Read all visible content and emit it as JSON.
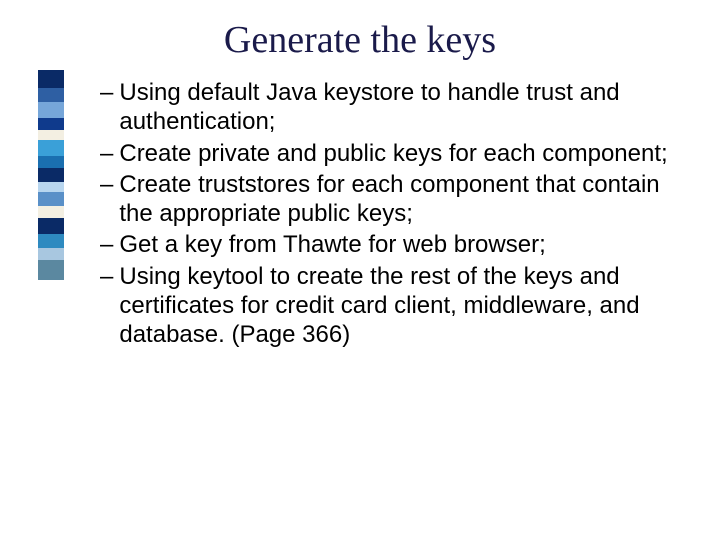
{
  "title": "Generate the keys",
  "bullets": [
    "Using default Java keystore to handle trust and authentication;",
    "Create private and public keys for each component;",
    "Create truststores for each component that contain the appropriate public keys;",
    "Get a key from Thawte for web browser;",
    "Using keytool to create the rest of the keys and certificates for credit card client, middleware, and database. (Page 366)"
  ],
  "decor_colors": [
    {
      "c": "#0a2a66",
      "h": 18
    },
    {
      "c": "#2e5fa3",
      "h": 14
    },
    {
      "c": "#76a6d9",
      "h": 16
    },
    {
      "c": "#0f3a8c",
      "h": 12
    },
    {
      "c": "#f3efe2",
      "h": 10
    },
    {
      "c": "#3aa0d8",
      "h": 16
    },
    {
      "c": "#1a6fb0",
      "h": 12
    },
    {
      "c": "#0a2a66",
      "h": 14
    },
    {
      "c": "#b8d6ef",
      "h": 10
    },
    {
      "c": "#5a90c8",
      "h": 14
    },
    {
      "c": "#f3efe2",
      "h": 12
    },
    {
      "c": "#0a2a66",
      "h": 16
    },
    {
      "c": "#2e8ac0",
      "h": 14
    },
    {
      "c": "#a8c7e0",
      "h": 12
    },
    {
      "c": "#5b88a0",
      "h": 20
    }
  ]
}
